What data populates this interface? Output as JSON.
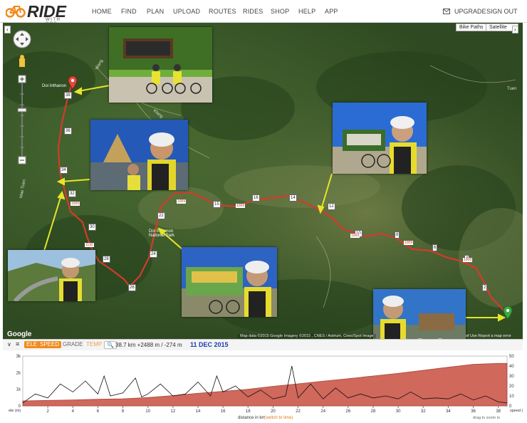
{
  "brand": {
    "name": "RIDE",
    "tagline": "WITH GPS"
  },
  "nav": {
    "home": "HOME",
    "find": "FIND",
    "plan": "PLAN",
    "upload": "UPLOAD",
    "routes": "ROUTES",
    "rides": "RIDES",
    "shop": "SHOP",
    "help": "HELP",
    "app": "APP",
    "upgrade": "UPGRADE",
    "signout": "SIGN OUT"
  },
  "map": {
    "layer_toggle": "Bike Paths",
    "map_type": "Satellite",
    "attribution": "Map data ©2015 Google Imagery ©2015 , CNES / Astrium, Cnes/Spot Image",
    "terms": "of Use   Report a map error",
    "google": "Google",
    "place_labels": {
      "doi": "Doi Inthanon",
      "park": "Doi Inthanon National Park",
      "tuen": "Tuen",
      "mae": "Mae Tuen",
      "klang": "Klang",
      "wang": "Wang"
    },
    "km_markers": [
      "38",
      "36",
      "34",
      "32",
      "30",
      "28",
      "26",
      "24",
      "22",
      "16",
      "15",
      "14",
      "12",
      "10",
      "8",
      "6",
      "4",
      "2"
    ],
    "road_labels": [
      "1009",
      "1192",
      "1009",
      "1009",
      "1009",
      "1009",
      "1009"
    ],
    "route_color": "#d33b2c"
  },
  "elevation_toolbar": {
    "ele": "ELE",
    "speed": "SPEED",
    "grade": "GRADE",
    "temp": "TEMP",
    "stats": "38.7 km +2488 m / -274 m",
    "date": "11 DEC 2015"
  },
  "elevation_chart": {
    "y_left_ticks": [
      "3k",
      "2k",
      "1k",
      "0"
    ],
    "y_right_ticks": [
      "50",
      "40",
      "30",
      "20",
      "10",
      "0"
    ],
    "y_left_label": "ele (m)",
    "y_right_label": "speed (kph)",
    "x_ticks": [
      "2",
      "4",
      "6",
      "8",
      "10",
      "12",
      "14",
      "16",
      "18",
      "20",
      "22",
      "24",
      "26",
      "28",
      "30",
      "32",
      "34",
      "36",
      "38"
    ],
    "x_label": "distance in km",
    "switch_label": "(switch to time)",
    "hint": "drag to zoom in"
  },
  "chart_data": {
    "type": "area",
    "xlabel": "distance in km",
    "ylabel": "ele (m)",
    "xlim": [
      0,
      38.7
    ],
    "ylim": [
      0,
      3000
    ],
    "y2lim": [
      0,
      50
    ],
    "series": [
      {
        "name": "ELE",
        "x": [
          0,
          2,
          4,
          6,
          8,
          10,
          12,
          14,
          16,
          18,
          20,
          22,
          24,
          26,
          28,
          30,
          32,
          34,
          36,
          38,
          38.7
        ],
        "values": [
          300,
          330,
          360,
          400,
          430,
          500,
          620,
          760,
          880,
          1000,
          1180,
          1330,
          1490,
          1640,
          1800,
          1960,
          2140,
          2330,
          2500,
          2560,
          2560
        ]
      },
      {
        "name": "SPEED",
        "x": [
          0,
          1,
          2,
          3,
          4,
          5,
          6,
          6.5,
          7,
          8,
          9,
          9.5,
          10,
          11,
          12,
          13,
          14,
          15,
          15.5,
          16,
          17,
          18,
          19,
          20,
          21,
          21.5,
          22,
          23,
          24,
          25,
          26,
          27,
          28,
          29,
          30,
          31,
          32,
          33,
          34,
          35,
          36,
          37,
          38,
          38.7
        ],
        "values": [
          3,
          12,
          8,
          22,
          14,
          25,
          12,
          30,
          10,
          13,
          28,
          9,
          12,
          22,
          10,
          12,
          24,
          10,
          30,
          14,
          20,
          9,
          16,
          7,
          10,
          40,
          8,
          22,
          7,
          18,
          8,
          12,
          8,
          10,
          7,
          14,
          7,
          8,
          7,
          12,
          6,
          10,
          4,
          3
        ]
      }
    ]
  }
}
